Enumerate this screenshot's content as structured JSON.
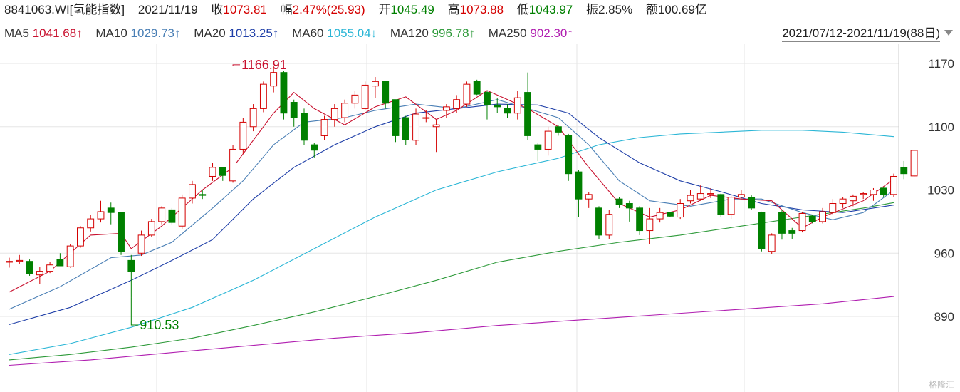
{
  "header": {
    "code": "8841063.WI[氢能指数]",
    "date": "2021/11/19",
    "close_label": "收",
    "close_value": "1073.81",
    "close_color": "#d40000",
    "change_label": "幅",
    "change_value": "2.47%(25.93)",
    "change_color": "#d40000",
    "open_label": "开",
    "open_value": "1045.49",
    "open_color": "#008000",
    "high_label": "高",
    "high_value": "1073.88",
    "high_color": "#d40000",
    "low_label": "低",
    "low_value": "1043.97",
    "low_color": "#008000",
    "amp_label": "振",
    "amp_value": "2.85%",
    "amp_color": "#222222",
    "amount_label": "额",
    "amount_value": "100.69亿",
    "amount_color": "#222222"
  },
  "ma_legend": [
    {
      "label": "MA5",
      "value": "1041.68↑",
      "color": "#c8102e"
    },
    {
      "label": "MA10",
      "value": "1029.73↑",
      "color": "#4a7fb5"
    },
    {
      "label": "MA20",
      "value": "1013.25↑",
      "color": "#1f3fa8"
    },
    {
      "label": "MA60",
      "value": "1055.04↓",
      "color": "#2bb6d6"
    },
    {
      "label": "MA120",
      "value": "996.78↑",
      "color": "#2e9a3a"
    },
    {
      "label": "MA250",
      "value": "902.30↑",
      "color": "#b01eb0"
    }
  ],
  "range": {
    "text": "2021/07/12-2021/11/19(88日)"
  },
  "watermark": "格隆汇",
  "colors": {
    "up": "#d40000",
    "down": "#008000",
    "grid": "#e6e6e6",
    "axis_text": "#333333"
  },
  "chart_data": {
    "type": "candlestick",
    "x_start": "2021/07/12",
    "x_end": "2021/11/19",
    "sessions": 88,
    "ylim": [
      890,
      1190
    ],
    "y_ticks": [
      1170,
      1100,
      1030,
      960,
      890
    ],
    "grid": true,
    "annotations": [
      {
        "text": "1166.91",
        "x": 22,
        "y": 1166.91,
        "color": "#c8102e"
      },
      {
        "text": "910.53",
        "x": 12,
        "y": 910.53,
        "color": "#008000"
      }
    ],
    "candles": [
      {
        "o": 950,
        "h": 955,
        "l": 944,
        "c": 951
      },
      {
        "o": 951,
        "h": 958,
        "l": 948,
        "c": 952
      },
      {
        "o": 951,
        "h": 953,
        "l": 935,
        "c": 937
      },
      {
        "o": 936,
        "h": 945,
        "l": 926,
        "c": 940
      },
      {
        "o": 940,
        "h": 950,
        "l": 938,
        "c": 947
      },
      {
        "o": 953,
        "h": 960,
        "l": 948,
        "c": 946
      },
      {
        "o": 945,
        "h": 970,
        "l": 944,
        "c": 968
      },
      {
        "o": 968,
        "h": 990,
        "l": 966,
        "c": 988
      },
      {
        "o": 988,
        "h": 1002,
        "l": 984,
        "c": 998
      },
      {
        "o": 998,
        "h": 1018,
        "l": 994,
        "c": 1006
      },
      {
        "o": 1010,
        "h": 1016,
        "l": 992,
        "c": 1005
      },
      {
        "o": 1005,
        "h": 1004,
        "l": 958,
        "c": 962
      },
      {
        "o": 952,
        "h": 958,
        "l": 910.53,
        "c": 940
      },
      {
        "o": 960,
        "h": 985,
        "l": 957,
        "c": 980
      },
      {
        "o": 980,
        "h": 998,
        "l": 978,
        "c": 995
      },
      {
        "o": 995,
        "h": 1012,
        "l": 992,
        "c": 1010
      },
      {
        "o": 1008,
        "h": 1010,
        "l": 992,
        "c": 994
      },
      {
        "o": 990,
        "h": 1025,
        "l": 987,
        "c": 1021
      },
      {
        "o": 1021,
        "h": 1040,
        "l": 1015,
        "c": 1036
      },
      {
        "o": 1025,
        "h": 1030,
        "l": 1020,
        "c": 1024
      },
      {
        "o": 1045,
        "h": 1060,
        "l": 1040,
        "c": 1055
      },
      {
        "o": 1055,
        "h": 1052,
        "l": 1040,
        "c": 1046
      },
      {
        "o": 1040,
        "h": 1080,
        "l": 1038,
        "c": 1075
      },
      {
        "o": 1075,
        "h": 1110,
        "l": 1070,
        "c": 1105
      },
      {
        "o": 1100,
        "h": 1125,
        "l": 1095,
        "c": 1120
      },
      {
        "o": 1120,
        "h": 1150,
        "l": 1116,
        "c": 1147
      },
      {
        "o": 1145,
        "h": 1166.91,
        "l": 1138,
        "c": 1160
      },
      {
        "o": 1160,
        "h": 1162,
        "l": 1108,
        "c": 1115
      },
      {
        "o": 1127,
        "h": 1130,
        "l": 1100,
        "c": 1110
      },
      {
        "o": 1115,
        "h": 1120,
        "l": 1080,
        "c": 1085
      },
      {
        "o": 1080,
        "h": 1082,
        "l": 1066,
        "c": 1074
      },
      {
        "o": 1090,
        "h": 1112,
        "l": 1085,
        "c": 1108
      },
      {
        "o": 1108,
        "h": 1125,
        "l": 1100,
        "c": 1120
      },
      {
        "o": 1110,
        "h": 1130,
        "l": 1105,
        "c": 1126
      },
      {
        "o": 1126,
        "h": 1140,
        "l": 1120,
        "c": 1135
      },
      {
        "o": 1120,
        "h": 1150,
        "l": 1118,
        "c": 1146
      },
      {
        "o": 1145,
        "h": 1155,
        "l": 1132,
        "c": 1150
      },
      {
        "o": 1150,
        "h": 1146,
        "l": 1120,
        "c": 1126
      },
      {
        "o": 1130,
        "h": 1128,
        "l": 1083,
        "c": 1090
      },
      {
        "o": 1110,
        "h": 1112,
        "l": 1080,
        "c": 1086
      },
      {
        "o": 1085,
        "h": 1120,
        "l": 1080,
        "c": 1114
      },
      {
        "o": 1110,
        "h": 1118,
        "l": 1105,
        "c": 1110
      },
      {
        "o": 1100,
        "h": 1108,
        "l": 1072,
        "c": 1102
      },
      {
        "o": 1118,
        "h": 1125,
        "l": 1110,
        "c": 1122
      },
      {
        "o": 1120,
        "h": 1135,
        "l": 1115,
        "c": 1130
      },
      {
        "o": 1125,
        "h": 1150,
        "l": 1122,
        "c": 1147
      },
      {
        "o": 1150,
        "h": 1152,
        "l": 1135,
        "c": 1136
      },
      {
        "o": 1138,
        "h": 1140,
        "l": 1108,
        "c": 1124
      },
      {
        "o": 1124,
        "h": 1132,
        "l": 1115,
        "c": 1122
      },
      {
        "o": 1120,
        "h": 1125,
        "l": 1110,
        "c": 1115
      },
      {
        "o": 1115,
        "h": 1140,
        "l": 1108,
        "c": 1132
      },
      {
        "o": 1138,
        "h": 1160,
        "l": 1085,
        "c": 1090
      },
      {
        "o": 1080,
        "h": 1082,
        "l": 1062,
        "c": 1075
      },
      {
        "o": 1075,
        "h": 1100,
        "l": 1068,
        "c": 1095
      },
      {
        "o": 1100,
        "h": 1102,
        "l": 1090,
        "c": 1094
      },
      {
        "o": 1090,
        "h": 1092,
        "l": 1040,
        "c": 1048
      },
      {
        "o": 1050,
        "h": 1052,
        "l": 1000,
        "c": 1020
      },
      {
        "o": 1020,
        "h": 1028,
        "l": 1010,
        "c": 1025
      },
      {
        "o": 1010,
        "h": 1012,
        "l": 976,
        "c": 980
      },
      {
        "o": 980,
        "h": 1008,
        "l": 976,
        "c": 1003
      },
      {
        "o": 1020,
        "h": 1022,
        "l": 1010,
        "c": 1014
      },
      {
        "o": 1015,
        "h": 1018,
        "l": 995,
        "c": 1010
      },
      {
        "o": 1010,
        "h": 1012,
        "l": 980,
        "c": 985
      },
      {
        "o": 985,
        "h": 1010,
        "l": 970,
        "c": 998
      },
      {
        "o": 998,
        "h": 1010,
        "l": 994,
        "c": 1005
      },
      {
        "o": 1005,
        "h": 1002,
        "l": 1000,
        "c": 1001
      },
      {
        "o": 1000,
        "h": 1020,
        "l": 998,
        "c": 1015
      },
      {
        "o": 1018,
        "h": 1030,
        "l": 1015,
        "c": 1024
      },
      {
        "o": 1020,
        "h": 1035,
        "l": 1018,
        "c": 1026
      },
      {
        "o": 1025,
        "h": 1032,
        "l": 1021,
        "c": 1026
      },
      {
        "o": 1025,
        "h": 1026,
        "l": 1000,
        "c": 1003
      },
      {
        "o": 1003,
        "h": 1025,
        "l": 998,
        "c": 1022
      },
      {
        "o": 1022,
        "h": 1030,
        "l": 1020,
        "c": 1025
      },
      {
        "o": 1022,
        "h": 1024,
        "l": 1008,
        "c": 1010
      },
      {
        "o": 1005,
        "h": 1006,
        "l": 962,
        "c": 965
      },
      {
        "o": 962,
        "h": 982,
        "l": 959,
        "c": 980
      },
      {
        "o": 1005,
        "h": 1008,
        "l": 975,
        "c": 982
      },
      {
        "o": 985,
        "h": 988,
        "l": 976,
        "c": 982
      },
      {
        "o": 985,
        "h": 1006,
        "l": 983,
        "c": 1004
      },
      {
        "o": 1001,
        "h": 1002,
        "l": 993,
        "c": 995
      },
      {
        "o": 995,
        "h": 1010,
        "l": 993,
        "c": 1006
      },
      {
        "o": 1005,
        "h": 1020,
        "l": 1002,
        "c": 1015
      },
      {
        "o": 1015,
        "h": 1022,
        "l": 1010,
        "c": 1020
      },
      {
        "o": 1018,
        "h": 1025,
        "l": 1012,
        "c": 1023
      },
      {
        "o": 1025,
        "h": 1028,
        "l": 1020,
        "c": 1026
      },
      {
        "o": 1025,
        "h": 1032,
        "l": 1018,
        "c": 1030
      },
      {
        "o": 1032,
        "h": 1033,
        "l": 1022,
        "c": 1025
      },
      {
        "o": 1025,
        "h": 1048,
        "l": 1022,
        "c": 1045
      },
      {
        "o": 1055,
        "h": 1062,
        "l": 1042,
        "c": 1048
      },
      {
        "o": 1045.49,
        "h": 1073.88,
        "l": 1043.97,
        "c": 1073.81
      }
    ],
    "ma_lines": [
      {
        "name": "MA5",
        "color": "#c8102e",
        "points": [
          [
            0,
            917
          ],
          [
            4,
            940
          ],
          [
            8,
            980
          ],
          [
            11,
            982
          ],
          [
            12,
            965
          ],
          [
            15,
            990
          ],
          [
            19,
            1030
          ],
          [
            22,
            1055
          ],
          [
            26,
            1115
          ],
          [
            28,
            1138
          ],
          [
            30,
            1120
          ],
          [
            33,
            1102
          ],
          [
            36,
            1122
          ],
          [
            39,
            1133
          ],
          [
            42,
            1108
          ],
          [
            44,
            1118
          ],
          [
            47,
            1140
          ],
          [
            51,
            1120
          ],
          [
            54,
            1100
          ],
          [
            57,
            1055
          ],
          [
            60,
            1015
          ],
          [
            63,
            1000
          ],
          [
            66,
            1008
          ],
          [
            69,
            1024
          ],
          [
            72,
            1020
          ],
          [
            75,
            1018
          ],
          [
            78,
            988
          ],
          [
            80,
            1000
          ],
          [
            84,
            1018
          ],
          [
            87,
            1041.68
          ]
        ]
      },
      {
        "name": "MA10",
        "color": "#4a7fb5",
        "points": [
          [
            0,
            898
          ],
          [
            5,
            923
          ],
          [
            10,
            955
          ],
          [
            13,
            958
          ],
          [
            16,
            972
          ],
          [
            20,
            1010
          ],
          [
            23,
            1040
          ],
          [
            26,
            1080
          ],
          [
            29,
            1105
          ],
          [
            33,
            1110
          ],
          [
            36,
            1118
          ],
          [
            40,
            1125
          ],
          [
            44,
            1120
          ],
          [
            48,
            1130
          ],
          [
            51,
            1120
          ],
          [
            54,
            1110
          ],
          [
            57,
            1080
          ],
          [
            60,
            1040
          ],
          [
            63,
            1018
          ],
          [
            67,
            1012
          ],
          [
            71,
            1020
          ],
          [
            74,
            1020
          ],
          [
            78,
            1005
          ],
          [
            81,
            997
          ],
          [
            84,
            1005
          ],
          [
            87,
            1029.73
          ]
        ]
      },
      {
        "name": "MA20",
        "color": "#1f3fa8",
        "points": [
          [
            0,
            881
          ],
          [
            6,
            900
          ],
          [
            12,
            930
          ],
          [
            16,
            952
          ],
          [
            20,
            975
          ],
          [
            24,
            1020
          ],
          [
            28,
            1055
          ],
          [
            32,
            1080
          ],
          [
            36,
            1100
          ],
          [
            40,
            1115
          ],
          [
            44,
            1120
          ],
          [
            48,
            1125
          ],
          [
            52,
            1124
          ],
          [
            55,
            1115
          ],
          [
            58,
            1088
          ],
          [
            62,
            1060
          ],
          [
            66,
            1040
          ],
          [
            70,
            1028
          ],
          [
            74,
            1015
          ],
          [
            78,
            1008
          ],
          [
            82,
            1005
          ],
          [
            87,
            1013.25
          ]
        ]
      },
      {
        "name": "MA60",
        "color": "#2bb6d6",
        "points": [
          [
            0,
            848
          ],
          [
            6,
            860
          ],
          [
            12,
            878
          ],
          [
            18,
            900
          ],
          [
            24,
            930
          ],
          [
            30,
            965
          ],
          [
            36,
            1000
          ],
          [
            42,
            1030
          ],
          [
            48,
            1050
          ],
          [
            54,
            1065
          ],
          [
            58,
            1080
          ],
          [
            62,
            1088
          ],
          [
            66,
            1092
          ],
          [
            70,
            1094
          ],
          [
            74,
            1096
          ],
          [
            78,
            1096
          ],
          [
            82,
            1094
          ],
          [
            87,
            1089
          ]
        ]
      },
      {
        "name": "MA120",
        "color": "#2e9a3a",
        "points": [
          [
            0,
            842
          ],
          [
            6,
            848
          ],
          [
            12,
            856
          ],
          [
            18,
            866
          ],
          [
            24,
            880
          ],
          [
            30,
            895
          ],
          [
            36,
            912
          ],
          [
            42,
            930
          ],
          [
            48,
            950
          ],
          [
            54,
            962
          ],
          [
            60,
            972
          ],
          [
            66,
            980
          ],
          [
            72,
            990
          ],
          [
            78,
            1000
          ],
          [
            84,
            1010
          ],
          [
            87,
            1016
          ]
        ]
      },
      {
        "name": "MA250",
        "color": "#b01eb0",
        "points": [
          [
            0,
            836
          ],
          [
            8,
            842
          ],
          [
            16,
            850
          ],
          [
            24,
            858
          ],
          [
            32,
            866
          ],
          [
            40,
            872
          ],
          [
            48,
            880
          ],
          [
            56,
            886
          ],
          [
            64,
            892
          ],
          [
            72,
            898
          ],
          [
            80,
            904
          ],
          [
            87,
            912
          ]
        ]
      }
    ]
  }
}
